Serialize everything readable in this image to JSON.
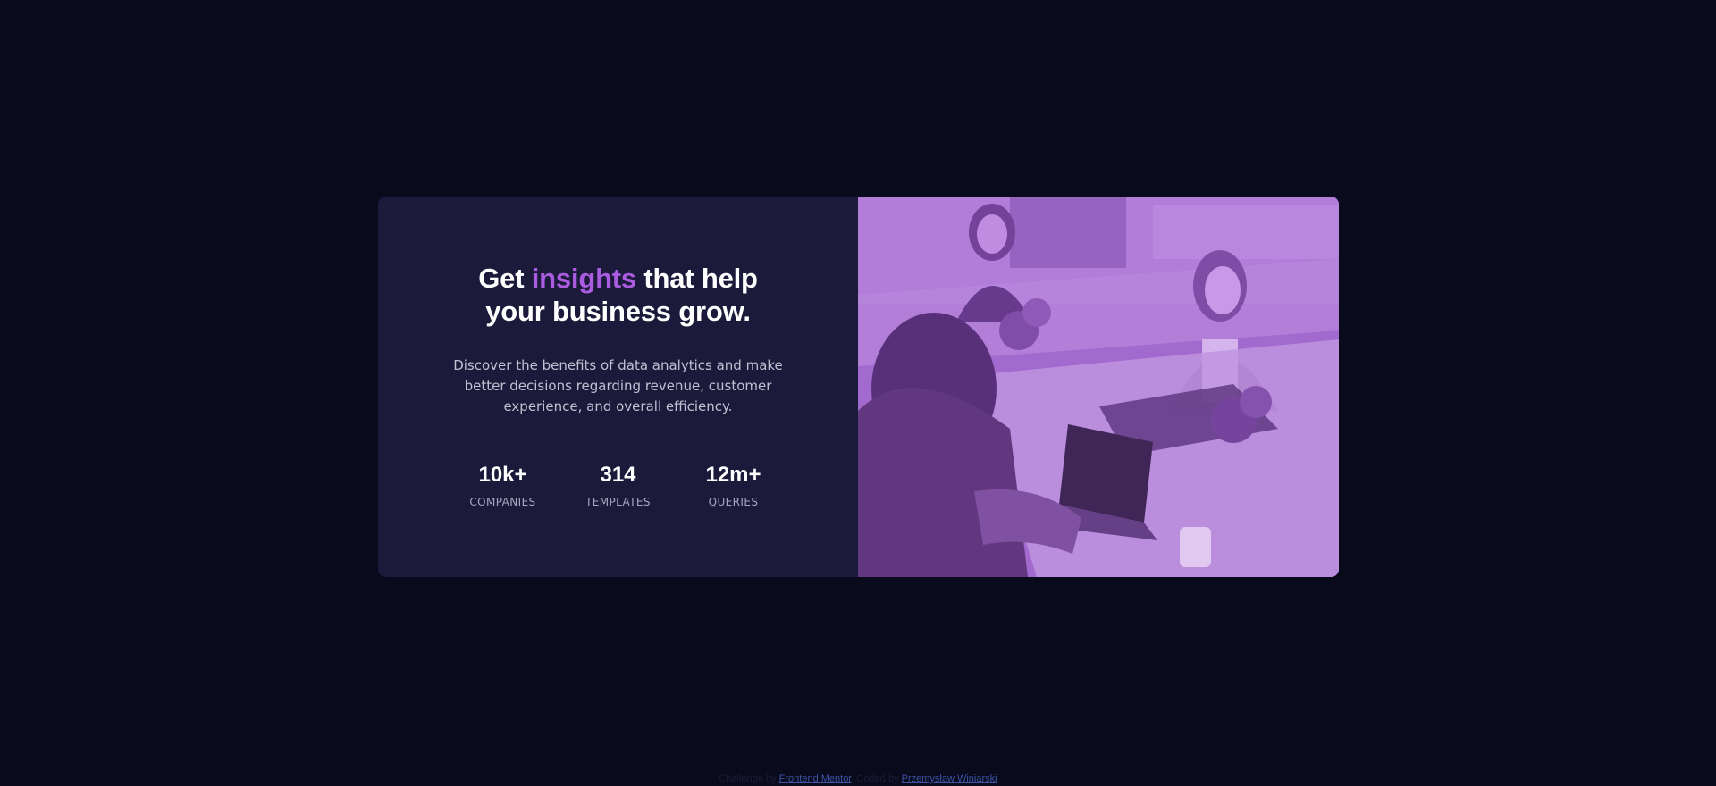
{
  "hero": {
    "headline_part1": "Get ",
    "headline_accent": "insights",
    "headline_part2": " that help",
    "headline_line2": "your business grow.",
    "lead": "Discover the benefits of data analytics and make better decisions regarding revenue, customer experience, and overall efficiency."
  },
  "stats": [
    {
      "value": "10k+",
      "label": "COMPANIES"
    },
    {
      "value": "314",
      "label": "TEMPLATES"
    },
    {
      "value": "12m+",
      "label": "QUERIES"
    }
  ],
  "image": {
    "icon": "office-photo-icon"
  },
  "attribution": {
    "prefix": "Challenge by ",
    "link1": "Frontend Mentor",
    "middle": ". Coded by ",
    "link2": "Przemysław Winiarski"
  },
  "colors": {
    "page_bg": "#090b1c",
    "card_bg": "#1c1a3a",
    "accent": "#aa5ce0",
    "image_tint": "#a56ed3"
  }
}
